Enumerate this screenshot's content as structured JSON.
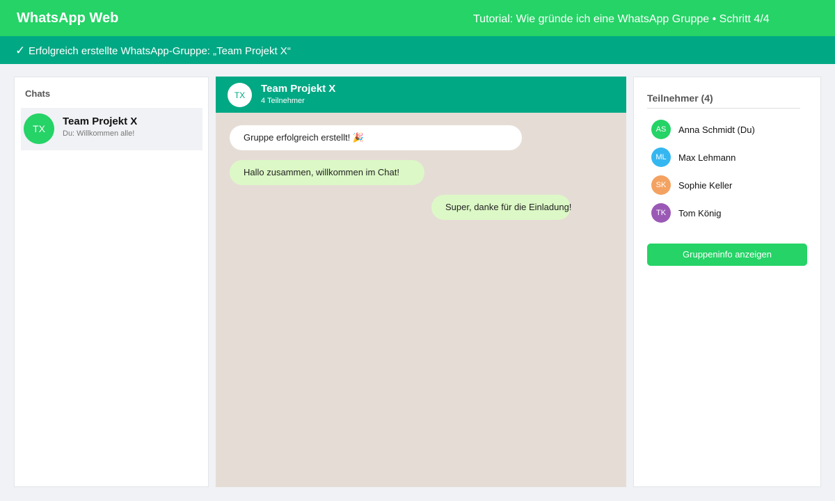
{
  "app": {
    "brand": "WhatsApp Web",
    "tutorial": "Tutorial: Wie gründe ich eine WhatsApp Gruppe • Schritt 4/4"
  },
  "banner": {
    "check": "✓",
    "message": "Erfolgreich erstellte WhatsApp-Gruppe: „Team Projekt X“"
  },
  "sidebar": {
    "header": "Chats",
    "chats": [
      {
        "initials": "TX",
        "name": "Team Projekt X",
        "preview": "Du: Willkommen alle!"
      }
    ]
  },
  "chat": {
    "initials": "TX",
    "title": "Team Projekt X",
    "subtitle": "4 Teilnehmer",
    "messages": [
      {
        "kind": "system",
        "text": "Gruppe erfolgreich erstellt! 🎉"
      },
      {
        "kind": "incoming",
        "text": "Hallo zusammen, willkommen im Chat!"
      },
      {
        "kind": "outgoing",
        "text": "Super, danke für die Einladung!"
      }
    ]
  },
  "participants": {
    "header": "Teilnehmer (4)",
    "members": [
      {
        "initials": "AS",
        "name": "Anna Schmidt (Du)",
        "color": "#25d366"
      },
      {
        "initials": "ML",
        "name": "Max Lehmann",
        "color": "#34b7f1"
      },
      {
        "initials": "SK",
        "name": "Sophie Keller",
        "color": "#f4a261"
      },
      {
        "initials": "TK",
        "name": "Tom König",
        "color": "#9b59b6"
      }
    ],
    "button_label": "Gruppeninfo anzeigen"
  },
  "colors": {
    "primary": "#25d366",
    "header_teal": "#00a884",
    "chat_background": "#e5ddd5",
    "bubble_green": "#dcf8c6"
  }
}
